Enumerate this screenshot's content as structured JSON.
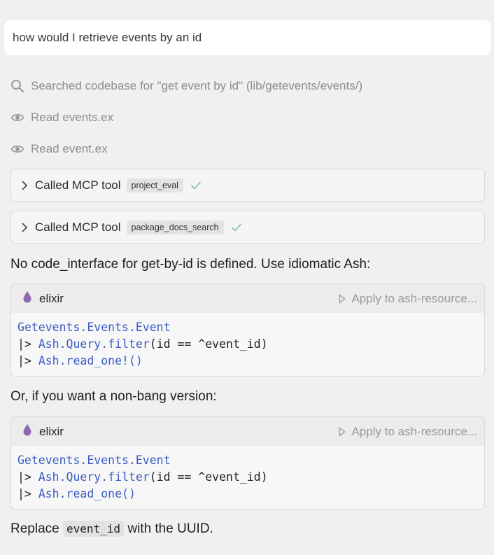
{
  "prompt": {
    "text": "how would I retrieve events  by an id"
  },
  "steps": [
    {
      "icon": "search-icon",
      "text": "Searched codebase for \"get event by id\" (lib/getevents/events/)"
    },
    {
      "icon": "eye-icon",
      "text": "Read events.ex"
    },
    {
      "icon": "eye-icon",
      "text": "Read event.ex"
    }
  ],
  "tool_calls": [
    {
      "label": "Called MCP tool",
      "tool": "project_eval",
      "status": "success"
    },
    {
      "label": "Called MCP tool",
      "tool": "package_docs_search",
      "status": "success"
    }
  ],
  "answer": {
    "intro": "No code_interface for get-by-id is defined. Use idiomatic Ash:",
    "alt_intro": "Or, if you want a non-bang version:",
    "outro_before": "Replace ",
    "outro_code": "event_id",
    "outro_after": " with the UUID."
  },
  "code_blocks": [
    {
      "language": "elixir",
      "apply_label": "Apply to ash-resource...",
      "lines": {
        "l1_mod": "Getevents.Events.Event",
        "l2_pipe": "|> ",
        "l2_mod": "Ash.Query.filter",
        "l2_rest": "(id == ^event_id)",
        "l3_pipe": "|> ",
        "l3_fn": "Ash.read_one!",
        "l3_rest": "()"
      }
    },
    {
      "language": "elixir",
      "apply_label": "Apply to ash-resource...",
      "lines": {
        "l1_mod": "Getevents.Events.Event",
        "l2_pipe": "|> ",
        "l2_mod": "Ash.Query.filter",
        "l2_rest": "(id == ^event_id)",
        "l3_pipe": "|> ",
        "l3_fn": "Ash.read_one",
        "l3_rest": "()"
      }
    }
  ],
  "colors": {
    "background": "#f0f0f0",
    "check": "#7cc49a",
    "elixir_drop": "#8e68b0",
    "code_token": "#3b5cc4"
  }
}
